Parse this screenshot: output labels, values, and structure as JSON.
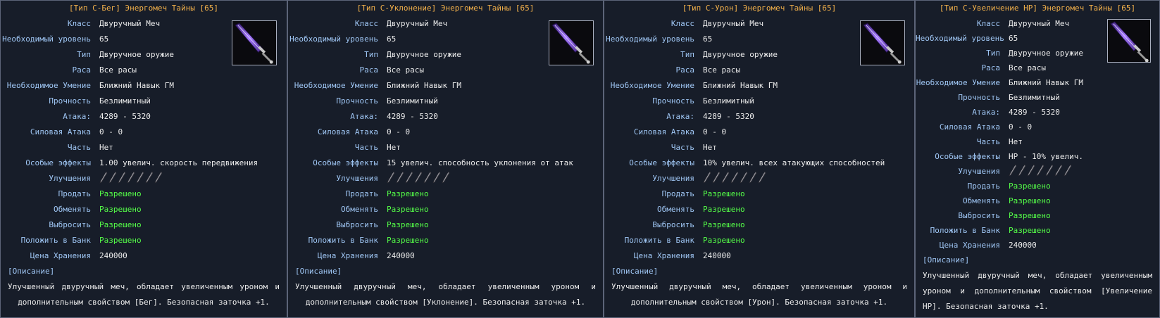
{
  "labels": {
    "class": "Класс",
    "level": "Необходимый уровень",
    "type": "Тип",
    "race": "Раса",
    "skill": "Необходимое Умение",
    "durability": "Прочность",
    "attack": "Атака:",
    "power": "Силовая Атака",
    "part": "Часть",
    "effects": "Особые эффекты",
    "upgrades": "Улучшения",
    "sell": "Продать",
    "exchange": "Обменять",
    "drop": "Выбросить",
    "bank": "Положить в Банк",
    "storage": "Цена Хранения",
    "desc_head": "[Описание]"
  },
  "colors": {
    "panel_bg": "#171d29",
    "title": "#f2b04a",
    "label": "#9fc6f4",
    "value": "#ececec",
    "allowed": "#55ff48",
    "blade": "#8d5cf0"
  },
  "icons": {
    "item": "purple-greatsword-icon",
    "upgrade": "dagger-rune-icon"
  },
  "upgrade_slots": 7,
  "panels": [
    {
      "title": "[Тип С-Бег] Энергомеч Тайны [65]",
      "class": "Двуручный Меч",
      "level": "65",
      "type": "Двуручное оружие",
      "race": "Все расы",
      "skill": "Ближний Навык ГМ",
      "durability": "Безлимитный",
      "attack": "4289 - 5320",
      "power": "0 - 0",
      "part": "Нет",
      "effects": "1.00 увелич. скорость передвижения",
      "sell": "Разрешено",
      "exchange": "Разрешено",
      "drop": "Разрешено",
      "bank": "Разрешено",
      "storage": "240000",
      "desc": "Улучшенный двуручный меч, обладает увеличенным уроном и дополнительным свойством [Бег]. Безопасная заточка +1."
    },
    {
      "title": "[Тип С-Уклонение] Энергомеч Тайны [65]",
      "class": "Двуручный Меч",
      "level": "65",
      "type": "Двуручное оружие",
      "race": "Все расы",
      "skill": "Ближний Навык ГМ",
      "durability": "Безлимитный",
      "attack": "4289 - 5320",
      "power": "0 - 0",
      "part": "Нет",
      "effects": "15 увелич. способность уклонения от атак",
      "sell": "Разрешено",
      "exchange": "Разрешено",
      "drop": "Разрешено",
      "bank": "Разрешено",
      "storage": "240000",
      "desc": "Улучшенный двуручный меч, обладает увеличенным уроном и дополнительным свойством [Уклонение]. Безопасная заточка +1."
    },
    {
      "title": "[Тип С-Урон] Энергомеч Тайны [65]",
      "class": "Двуручный Меч",
      "level": "65",
      "type": "Двуручное оружие",
      "race": "Все расы",
      "skill": "Ближний Навык ГМ",
      "durability": "Безлимитный",
      "attack": "4289 - 5320",
      "power": "0 - 0",
      "part": "Нет",
      "effects": "10% увелич. всех атакующих способностей",
      "sell": "Разрешено",
      "exchange": "Разрешено",
      "drop": "Разрешено",
      "bank": "Разрешено",
      "storage": "240000",
      "desc": "Улучшенный двуручный меч, обладает увеличенным уроном и дополнительным свойством [Урон]. Безопасная заточка +1."
    },
    {
      "title": "[Тип С-Увеличение HP] Энергомеч Тайны [65]",
      "class": "Двуручный Меч",
      "level": "65",
      "type": "Двуручное оружие",
      "race": "Все расы",
      "skill": "Ближний Навык ГМ",
      "durability": "Безлимитный",
      "attack": "4289 - 5320",
      "power": "0 - 0",
      "part": "Нет",
      "effects": "HP - 10% увелич.",
      "sell": "Разрешено",
      "exchange": "Разрешено",
      "drop": "Разрешено",
      "bank": "Разрешено",
      "storage": "240000",
      "desc": "Улучшенный двуручный меч, обладает увеличенным уроном и дополнительным свойством [Увеличение HP]. Безопасная заточка +1."
    }
  ]
}
